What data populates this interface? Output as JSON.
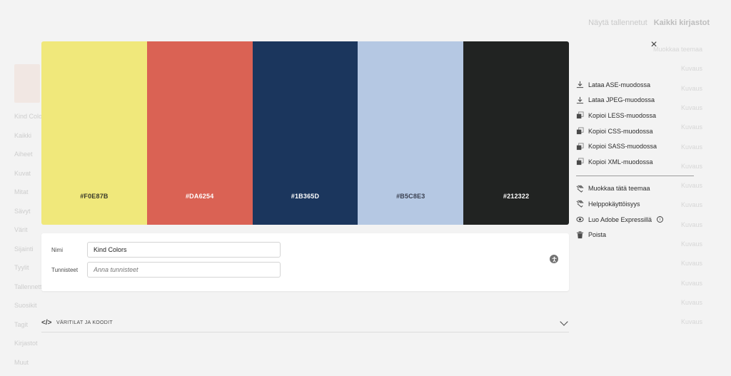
{
  "background": {
    "top_right_text": "Näytä tallennetut",
    "top_right_bold": "Kaikki kirjastot",
    "left_items": [
      "Kind Colors",
      "Kaikki",
      "Aiheet",
      "Kuvat",
      "Mitat",
      "Sävyt",
      "Värit",
      "Sijainti",
      "Tyylit",
      "Tallennettu",
      "Suosikit",
      "Tagit",
      "Kirjastot",
      "Muut"
    ],
    "right_items": [
      "Muokkaa teemaa",
      "Kuvaus",
      "Kuvaus",
      "Kuvaus",
      "Kuvaus",
      "Kuvaus",
      "Kuvaus",
      "Kuvaus",
      "Kuvaus",
      "Kuvaus",
      "Kuvaus",
      "Kuvaus",
      "Kuvaus",
      "Kuvaus",
      "Kuvaus"
    ]
  },
  "palette": {
    "swatches": [
      {
        "hex": "#F0E87B",
        "color": "#F0E87B",
        "text_color": "#3a3a2a"
      },
      {
        "hex": "#DA6254",
        "color": "#DA6254",
        "text_color": "#ffffff"
      },
      {
        "hex": "#1B365D",
        "color": "#1B365D",
        "text_color": "#ffffff"
      },
      {
        "hex": "#B5C8E3",
        "color": "#B5C8E3",
        "text_color": "#3a4050"
      },
      {
        "hex": "#212322",
        "color": "#212322",
        "text_color": "#ffffff"
      }
    ]
  },
  "meta": {
    "name_label": "Nimi",
    "name_value": "Kind Colors",
    "tags_label": "Tunnisteet",
    "tags_placeholder": "Anna tunnisteet"
  },
  "accordion": {
    "label": "VÄRITILAT JA KOODIT"
  },
  "close": {
    "label": "×"
  },
  "menu": {
    "group1": [
      {
        "label": "Lataa ASE-muodossa",
        "icon": "download-icon"
      },
      {
        "label": "Lataa JPEG-muodossa",
        "icon": "download-icon"
      },
      {
        "label": "Kopioi LESS-muodossa",
        "icon": "copy-icon"
      },
      {
        "label": "Kopioi CSS-muodossa",
        "icon": "copy-icon"
      },
      {
        "label": "Kopioi SASS-muodossa",
        "icon": "copy-icon"
      },
      {
        "label": "Kopioi XML-muodossa",
        "icon": "copy-icon"
      }
    ],
    "group2": [
      {
        "label": "Muokkaa tätä teemaa",
        "icon": "edit-theme-icon"
      },
      {
        "label": "Helppokäyttöisyys",
        "icon": "accessibility-icon"
      },
      {
        "label": "Luo Adobe Expressillä",
        "icon": "express-icon",
        "info": "i"
      },
      {
        "label": "Poista",
        "icon": "trash-icon"
      }
    ]
  }
}
